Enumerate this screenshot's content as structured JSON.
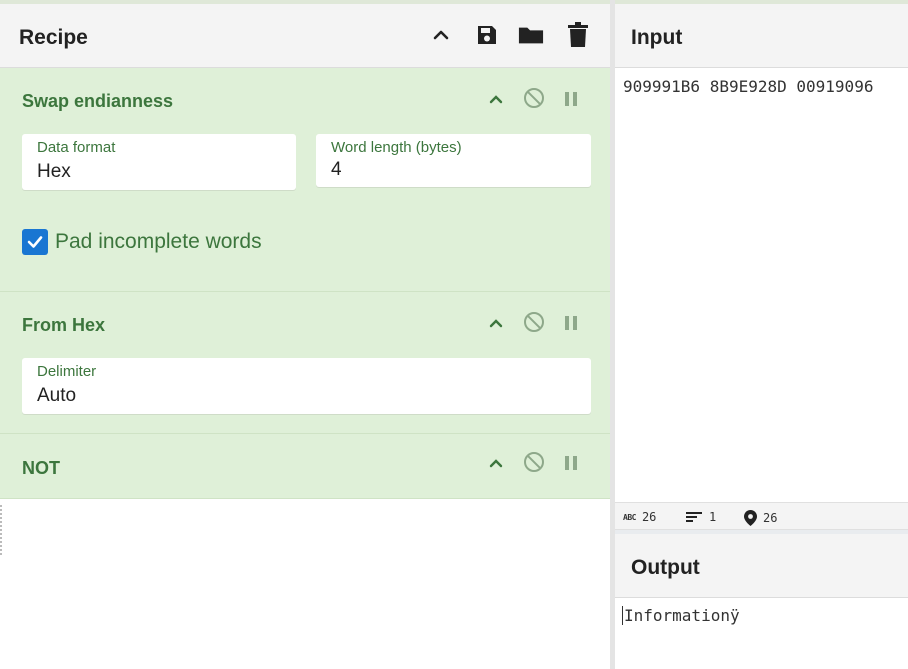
{
  "recipe": {
    "title": "Recipe",
    "icons": [
      "chevron-up-icon",
      "save-icon",
      "folder-icon",
      "trash-icon"
    ],
    "operations": [
      {
        "name": "Swap endianness",
        "fields": [
          {
            "label": "Data format",
            "value": "Hex"
          },
          {
            "label": "Word length (bytes)",
            "value": "4"
          }
        ],
        "checkbox": {
          "label": "Pad incomplete words",
          "checked": true
        }
      },
      {
        "name": "From Hex",
        "fields": [
          {
            "label": "Delimiter",
            "value": "Auto"
          }
        ]
      },
      {
        "name": "NOT"
      }
    ]
  },
  "input": {
    "title": "Input",
    "text": "909991B6 8B9E928D 00919096",
    "status": {
      "chars": "26",
      "lines": "1",
      "position": "26"
    }
  },
  "output": {
    "title": "Output",
    "text": "Informationÿ"
  },
  "colors": {
    "op_background": "#dff0d8",
    "op_text": "#3c763d",
    "checkbox": "#1976d2"
  }
}
